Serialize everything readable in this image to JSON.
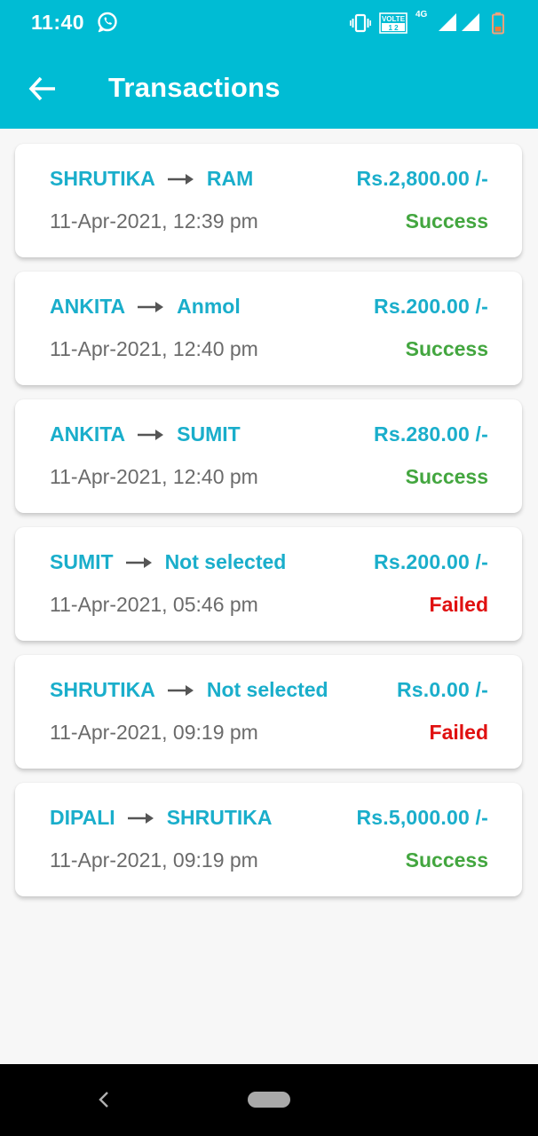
{
  "status_bar": {
    "time": "11:40",
    "volte": "VOLTE",
    "network": "4G",
    "icons": [
      "whatsapp-icon",
      "vibrate-icon",
      "volte-icon",
      "signal-icon",
      "battery-icon"
    ]
  },
  "app_bar": {
    "title": "Transactions",
    "back_icon": "arrow-left-icon",
    "color": "#00bcd4"
  },
  "colors": {
    "accent": "#1aaecb",
    "success": "#43a63f",
    "failed": "#e01010"
  },
  "transactions": [
    {
      "from": "SHRUTIKA",
      "to": "RAM",
      "amount": "Rs.2,800.00 /-",
      "datetime": "11-Apr-2021, 12:39 pm",
      "status": "Success"
    },
    {
      "from": "ANKITA",
      "to": "Anmol",
      "amount": "Rs.200.00 /-",
      "datetime": "11-Apr-2021, 12:40 pm",
      "status": "Success"
    },
    {
      "from": "ANKITA",
      "to": "SUMIT",
      "amount": "Rs.280.00 /-",
      "datetime": "11-Apr-2021, 12:40 pm",
      "status": "Success"
    },
    {
      "from": "SUMIT",
      "to": "Not selected",
      "amount": "Rs.200.00 /-",
      "datetime": "11-Apr-2021, 05:46 pm",
      "status": "Failed"
    },
    {
      "from": "SHRUTIKA",
      "to": "Not selected",
      "amount": "Rs.0.00 /-",
      "datetime": "11-Apr-2021, 09:19 pm",
      "status": "Failed"
    },
    {
      "from": "DIPALI",
      "to": "SHRUTIKA",
      "amount": "Rs.5,000.00 /-",
      "datetime": "11-Apr-2021, 09:19 pm",
      "status": "Success"
    }
  ],
  "nav_bar": {
    "icons": [
      "back-triangle-icon",
      "home-pill-icon"
    ]
  }
}
